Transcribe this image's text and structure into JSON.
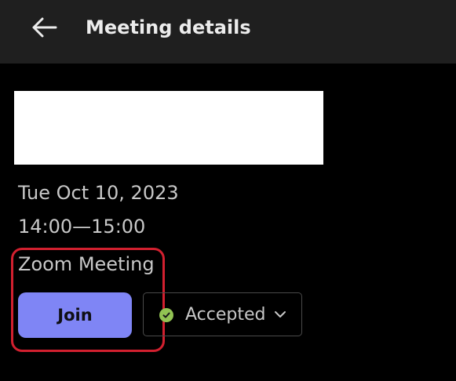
{
  "header": {
    "back_icon": "arrow-left-icon",
    "title": "Meeting details"
  },
  "meeting": {
    "date": "Tue Oct 10, 2023",
    "time": "14:00—15:00",
    "location": "Zoom Meeting"
  },
  "actions": {
    "join_label": "Join",
    "rsvp_status": "Accepted",
    "rsvp_icon": "accepted-check-icon",
    "rsvp_chevron_icon": "chevron-down-icon"
  },
  "colors": {
    "header_bg": "#1f1f1f",
    "background": "#000000",
    "join_button": "#7f85f5",
    "accepted_green": "#92c353",
    "highlight_red": "#d2202f"
  }
}
